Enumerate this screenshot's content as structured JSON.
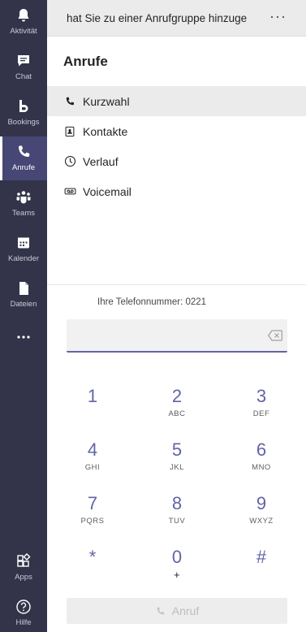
{
  "rail": {
    "items": [
      {
        "label": "Aktivität",
        "icon": "bell-icon"
      },
      {
        "label": "Chat",
        "icon": "chat-icon"
      },
      {
        "label": "Bookings",
        "icon": "bookings-icon"
      },
      {
        "label": "Anrufe",
        "icon": "phone-icon",
        "active": true
      },
      {
        "label": "Teams",
        "icon": "teams-icon"
      },
      {
        "label": "Kalender",
        "icon": "calendar-icon"
      },
      {
        "label": "Dateien",
        "icon": "file-icon"
      },
      {
        "label": "",
        "icon": "more-icon"
      },
      {
        "label": "Apps",
        "icon": "apps-icon"
      },
      {
        "label": "Hilfe",
        "icon": "help-icon"
      }
    ]
  },
  "banner": {
    "text": "hat Sie zu einer Anrufgruppe hinzugefügt",
    "more": "···"
  },
  "calls": {
    "title": "Anrufe",
    "nav": [
      {
        "label": "Kurzwahl",
        "icon": "phone-icon"
      },
      {
        "label": "Kontakte",
        "icon": "contact-card-icon"
      },
      {
        "label": "Verlauf",
        "icon": "clock-icon"
      },
      {
        "label": "Voicemail",
        "icon": "voicemail-icon"
      }
    ],
    "phone_number_label": "Ihre Telefonnummer: 0221",
    "dial_input_value": "",
    "keypad": [
      {
        "num": "1",
        "sub": ""
      },
      {
        "num": "2",
        "sub": "ABC"
      },
      {
        "num": "3",
        "sub": "DEF"
      },
      {
        "num": "4",
        "sub": "GHI"
      },
      {
        "num": "5",
        "sub": "JKL"
      },
      {
        "num": "6",
        "sub": "MNO"
      },
      {
        "num": "7",
        "sub": "PQRS"
      },
      {
        "num": "8",
        "sub": "TUV"
      },
      {
        "num": "9",
        "sub": "WXYZ"
      },
      {
        "num": "*",
        "sub": ""
      },
      {
        "num": "0",
        "sub": "+"
      },
      {
        "num": "#",
        "sub": ""
      }
    ],
    "call_button_label": "Anruf"
  },
  "colors": {
    "rail_bg": "#33344a",
    "rail_active": "#464775",
    "accent": "#6264a7"
  }
}
